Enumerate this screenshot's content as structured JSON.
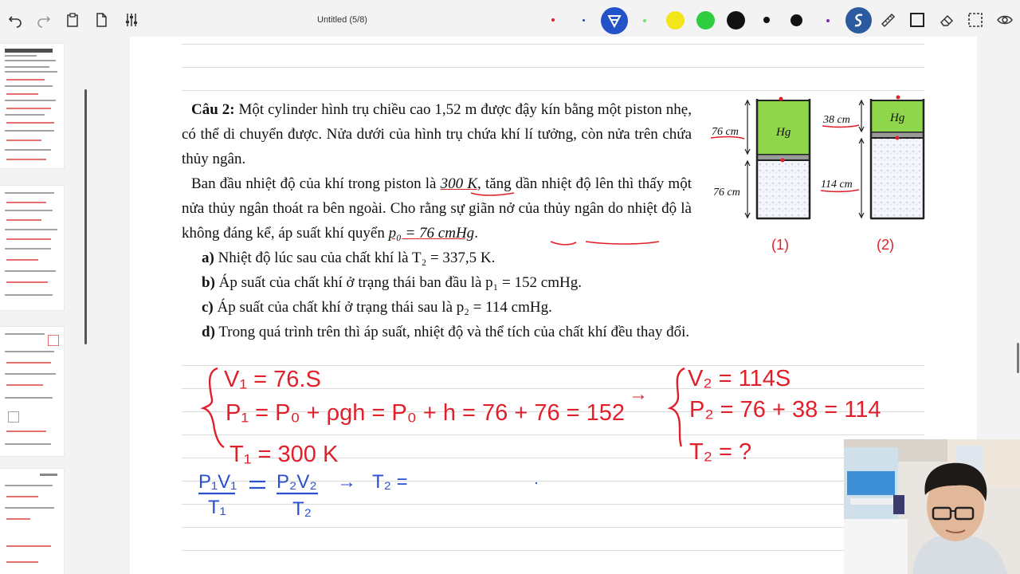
{
  "toolbar": {
    "title": "Untitled (5/8)",
    "icons": [
      "undo-icon",
      "redo-icon",
      "clipboard-icon",
      "page-icon",
      "sliders-icon"
    ],
    "pen_colors": [
      "#e11d2a",
      "#1e4fd0",
      "#6ee26a",
      "#f0e61a",
      "#2ecc40",
      "#111111",
      "#111111",
      "#111111",
      "#7a2db8"
    ],
    "tools": [
      "pen-tool",
      "highlighter",
      "ruler",
      "rectangle",
      "eraser",
      "lasso",
      "view"
    ]
  },
  "problem": {
    "heading": "Câu 2:",
    "p1": "Một cylinder hình trụ chiều cao 1,52 m được đậy kín bằng một piston nhẹ, có thể di chuyển được. Nửa dưới của hình trụ chứa khí lí tưởng, còn nửa trên chứa thủy ngân.",
    "p2a": "Ban đầu nhiệt độ của khí trong piston là ",
    "p2_temp": "300 K",
    "p2b": ", tăng dần nhiệt độ lên thì thấy một nửa thủy ngân thoát ra bên ngoài. Cho rằng sự giãn nở của thủy ngân do nhiệt độ là không đáng kể, áp suất khí quyển ",
    "p2_p0": "p₀ = 76 cmHg",
    "p2c": ".",
    "options": [
      {
        "label": "a)",
        "text": "Nhiệt độ lúc sau của chất khí là T₂ = 337,5 K."
      },
      {
        "label": "b)",
        "text": "Áp suất của chất khí ở trạng thái ban đầu là p₁ = 152 cmHg."
      },
      {
        "label": "c)",
        "text": "Áp suất của chất khí ở trạng thái sau là p₂ = 114 cmHg."
      },
      {
        "label": "d)",
        "text": "Trong quá trình trên thì áp suất, nhiệt độ và thể tích của chất khí đều thay đổi."
      }
    ]
  },
  "diagram": {
    "left_top": "76 cm",
    "left_bottom": "76 cm",
    "right_top": "38 cm",
    "right_bottom": "114 cm",
    "hg_label": "Hg",
    "label_1": "(1)",
    "label_2": "(2)",
    "hg_color": "#8fd64a"
  },
  "handwriting": {
    "v1": "V₁ = 76.S",
    "p1": "P₁ = P₀ + ρgh = P₀ + h = 76 + 76 = 152",
    "t1": "T₁ = 300 K",
    "arrow": "→",
    "v2": "V₂ = 114S",
    "p2": "P₂ = 76 + 38 = 114",
    "t2": "T₂ = ?",
    "eq_lhs_num": "P₁V₁",
    "eq_lhs_den": "T₁",
    "eq_rhs_num": "P₂V₂",
    "eq_rhs_den": "T₂",
    "eq_result": "T₂ =",
    "ink_color": "#e0202a",
    "blue_color": "#2a4fd0"
  }
}
